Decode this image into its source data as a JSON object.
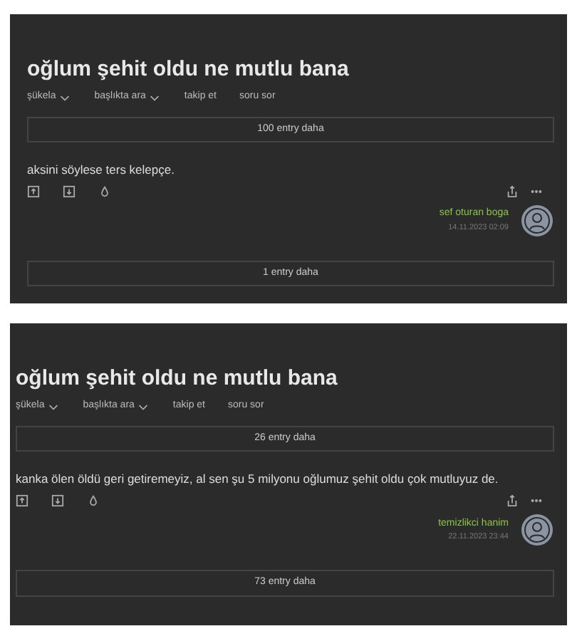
{
  "panels": [
    {
      "title": "oğlum şehit oldu ne mutlu bana",
      "actions": [
        {
          "label": "şükela",
          "dropdown": true
        },
        {
          "label": "başlıkta ara",
          "dropdown": true
        },
        {
          "label": "takip et",
          "dropdown": false
        },
        {
          "label": "soru sor",
          "dropdown": false
        }
      ],
      "more_before": "100 entry daha",
      "entry": {
        "text": "aksini söylese ters kelepçe.",
        "author": "sef oturan boga",
        "date": "14.11.2023 02:09"
      },
      "more_after": "1 entry daha"
    },
    {
      "title": "oğlum şehit oldu ne mutlu bana",
      "actions": [
        {
          "label": "şükela",
          "dropdown": true
        },
        {
          "label": "başlıkta ara",
          "dropdown": true
        },
        {
          "label": "takip et",
          "dropdown": false
        },
        {
          "label": "soru sor",
          "dropdown": false
        }
      ],
      "more_before": "26 entry daha",
      "entry": {
        "text": "kanka ölen öldü geri getiremeyiz, al sen şu 5 milyonu oğlumuz şehit oldu çok mutluyuz de.",
        "author": "temizlikci hanim",
        "date": "22.11.2023 23:44"
      },
      "more_after": "73 entry daha"
    }
  ]
}
